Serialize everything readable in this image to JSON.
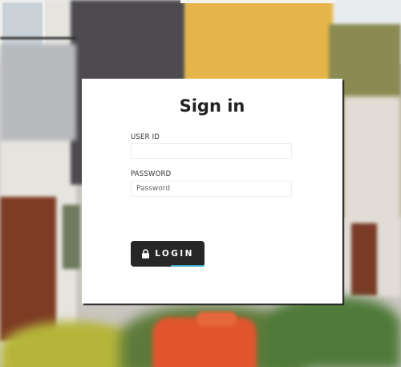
{
  "login": {
    "title": "Sign in",
    "user_id": {
      "label": "USER ID",
      "value": "",
      "placeholder": ""
    },
    "password": {
      "label": "PASSWORD",
      "value": "",
      "placeholder": "Password"
    },
    "button": {
      "label": "LOGIN",
      "icon": "lock-icon"
    }
  },
  "colors": {
    "card_background": "#ffffff",
    "button_background": "#272727",
    "button_accent": "#3aa6c9",
    "title_text": "#222222"
  }
}
